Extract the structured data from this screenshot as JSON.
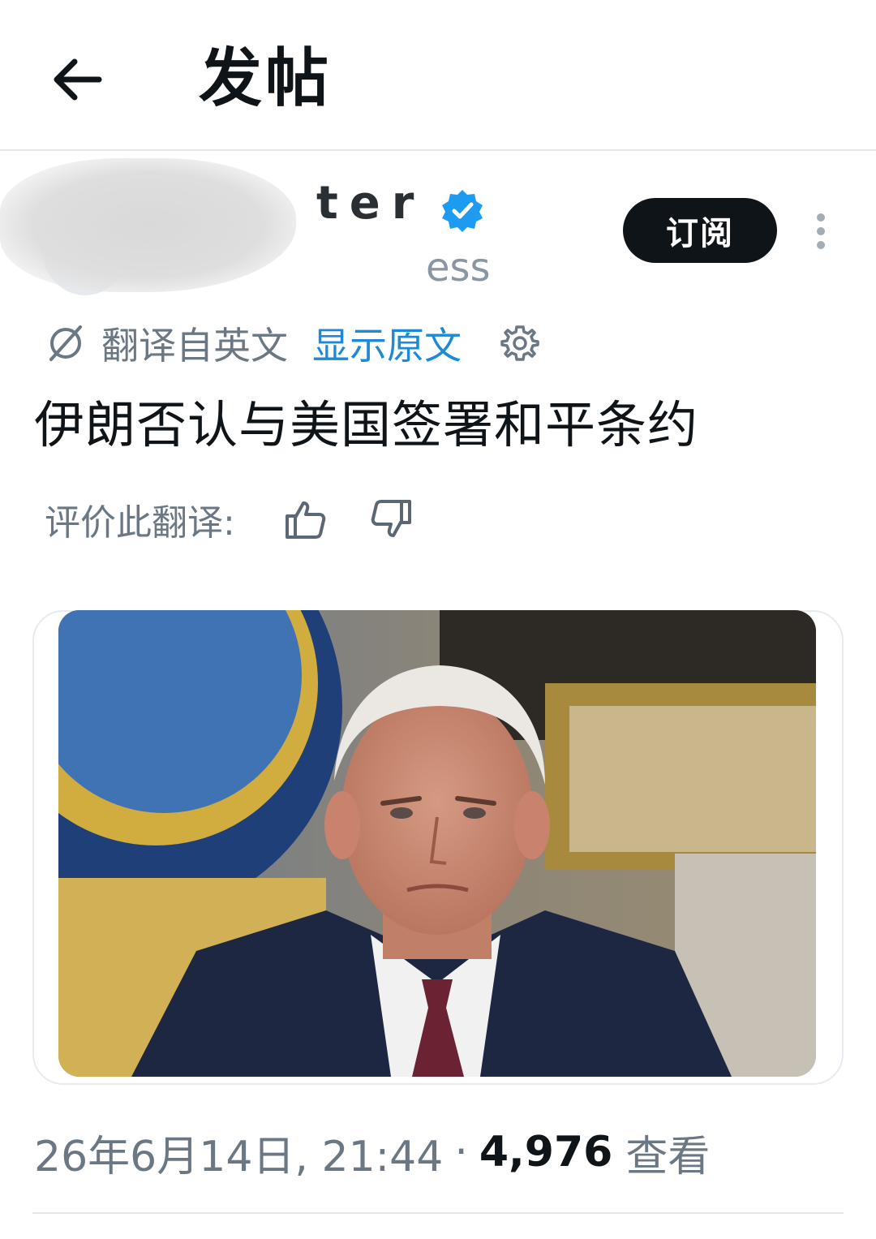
{
  "header": {
    "title": "发帖"
  },
  "author": {
    "name_visible": "ter",
    "handle_visible": "ess",
    "subscribe_label": "订阅"
  },
  "translation": {
    "translated_from": "翻译自英文",
    "show_original": "显示原文"
  },
  "tweet": {
    "text": "伊朗否认与美国签署和平条约"
  },
  "rating": {
    "label": "评价此翻译:"
  },
  "meta": {
    "date_time": "26年6月14日, 21:44",
    "separator": "·",
    "views_count": "4,976",
    "views_label": "查看"
  },
  "icons": {
    "back": "arrow-left-icon",
    "verified": "verified-badge-icon",
    "more": "more-vertical-icon",
    "translate": "translate-icon",
    "settings": "gear-icon",
    "thumb_up": "thumb-up-icon",
    "thumb_down": "thumb-down-icon"
  },
  "colors": {
    "link": "#1d8ad8",
    "verified": "#1d9bf0",
    "muted": "#6b7884",
    "button_bg": "#0f1419"
  }
}
